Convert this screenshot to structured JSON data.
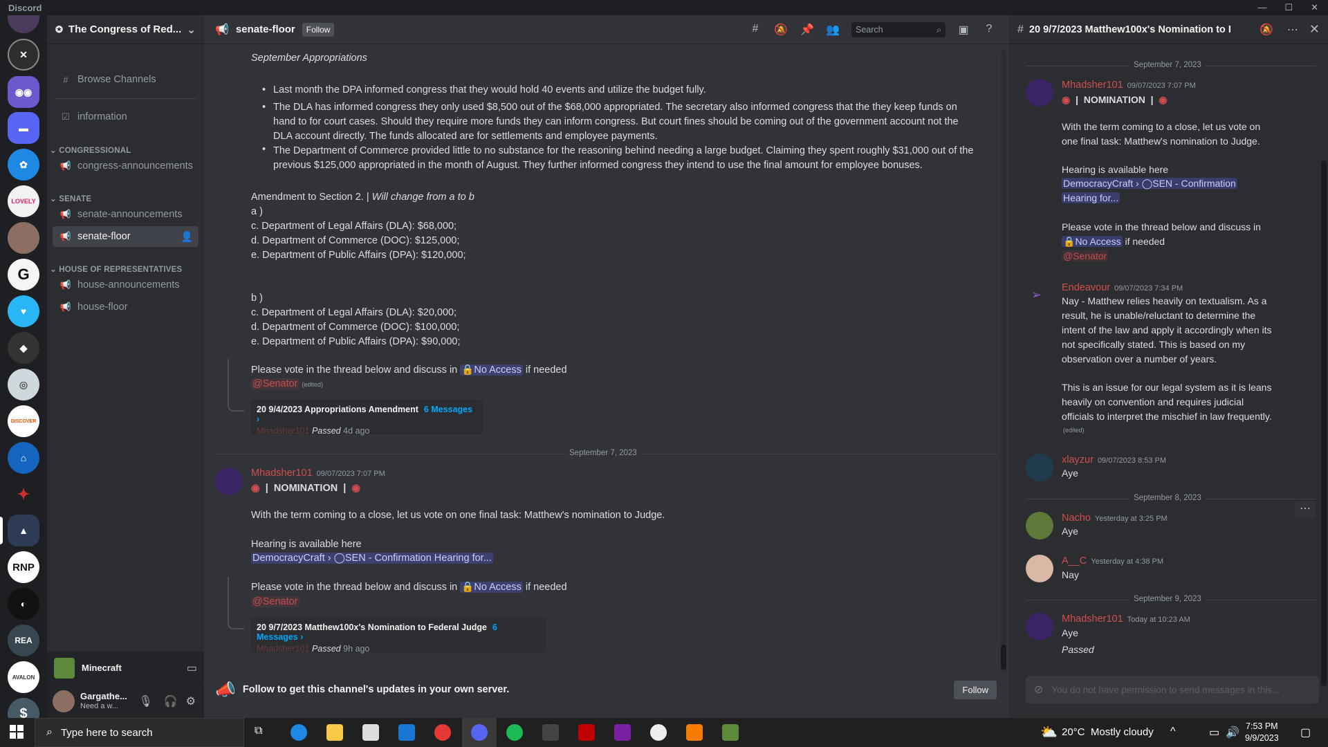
{
  "app": {
    "title": "Discord"
  },
  "server": {
    "name": "The Congress of Red..."
  },
  "sidebar": {
    "browse": "Browse Channels",
    "information": "information",
    "cat_congressional": "CONGRESSIONAL",
    "congress_announcements": "congress-announcements",
    "cat_senate": "SENATE",
    "senate_announcements": "senate-announcements",
    "senate_floor": "senate-floor",
    "cat_house": "HOUSE OF REPRESENTATIVES",
    "house_announcements": "house-announcements",
    "house_floor": "house-floor"
  },
  "voice": {
    "name": "Minecraft"
  },
  "user": {
    "name": "Gargathe...",
    "status": "Need a w..."
  },
  "header": {
    "channel": "senate-floor",
    "follow": "Follow",
    "search_placeholder": "Search"
  },
  "messages": {
    "heading": "September Appropriations",
    "bullets": [
      "Last month the DPA informed congress that they would hold 40 events and utilize the budget fully.",
      "The DLA has informed congress they only used $8,500 out of the $68,000 appropriated. The secretary also informed congress that the they keep funds on",
      "hand to for court cases. Should they require more funds they can inform congress. But court fines should be coming out of the government account not the",
      "DLA account directly. The funds allocated are for settlements and employee payments.",
      "The Department of Commerce provided little to no substance for the reasoning behind needing a large budget. Claiming they spent roughly $31,000 out of the",
      "previous $125,000 appropriated in the month of August. They further informed congress they intend to use the final amount for employee bonuses."
    ],
    "amend": "Amendment to Section 2. |",
    "amend_italic": "Will change from a to b",
    "a_lines": [
      "a )",
      "c. Department of Legal Affairs (DLA): $68,000;",
      "d. Department of Commerce (DOC): $125,000;",
      "e. Department of Public Affairs (DPA): $120,000;"
    ],
    "b_lines": [
      "b )",
      "c. Department of Legal Affairs (DLA): $20,000;",
      "d. Department of Commerce (DOC): $100,000;",
      "e. Department of Public Affairs (DPA): $90,000;"
    ],
    "vote_pre": "Please vote in the thread below and discuss in",
    "no_access": "No Access",
    "vote_post": "if needed",
    "senator": "@Senator",
    "edited": "(edited)",
    "thread1": {
      "title": "20 9/4/2023 Appropriations Amendment",
      "count": "6 Messages ›",
      "author": "Mhadsher101",
      "status": "Passed",
      "time": "4d ago"
    },
    "date1": "September 7, 2023",
    "m2_author": "Mhadsher101",
    "m2_time": "09/07/2023 7:07 PM",
    "nomination": "NOMINATION",
    "m2_text": "With the term coming to a close, let us vote on one final task: Matthew's nomination to Judge.",
    "hearing": "Hearing is available here",
    "hearing_link": "DemocracyCraft › ◯SEN - Confirmation Hearing for...",
    "thread2": {
      "title": "20 9/7/2023 Matthew100x's Nomination to Federal Judge",
      "count": "6 Messages ›",
      "author": "Mhadsher101",
      "status": "Passed",
      "time": "9h ago"
    }
  },
  "follow_bar": {
    "text": "Follow to get this channel's updates in your own server.",
    "button": "Follow"
  },
  "thread_panel": {
    "title": "20 9/7/2023 Matthew100x's Nomination to I",
    "date1": "September 7, 2023",
    "p1_author": "Mhadsher101",
    "p1_time": "09/07/2023 7:07 PM",
    "nomination": "NOMINATION",
    "p1_lines": [
      "With the term coming to a close, let us vote on",
      "one final task: Matthew's nomination to Judge."
    ],
    "hearing": "Hearing is available here",
    "link1": "DemocracyCraft › ◯SEN - Confirmation",
    "link2": "Hearing for...",
    "vote_pre": "Please vote in the thread below and discuss in",
    "no_access": "No Access",
    "vote_post": "if needed",
    "senator": "@Senator",
    "p2_author": "Endeavour",
    "p2_time": "09/07/2023 7:34 PM",
    "p2_lines": [
      "Nay - Matthew relies heavily on textualism. As a",
      "result, he is unable/reluctant to determine the",
      "intent of the law and apply it accordingly when its",
      "not specifically stated. This is based on my",
      "observation over a number of years."
    ],
    "p2b_lines": [
      "This is an issue for our legal system as it is leans",
      "heavily on convention and requires judicial",
      "officials to interpret the mischief in law frequently."
    ],
    "edited": "(edited)",
    "p3_author": "xlayzur",
    "p3_time": "09/07/2023 8:53 PM",
    "p3_text": "Aye",
    "date2": "September 8, 2023",
    "p4_author": "Nacho",
    "p4_time": "Yesterday at 3:25 PM",
    "p4_text": "Aye",
    "p5_author": "A__C",
    "p5_time": "Yesterday at 4:38 PM",
    "p5_text": "Nay",
    "date3": "September 9, 2023",
    "p6_author": "Mhadsher101",
    "p6_time": "Today at 10:23 AM",
    "p6_text": "Aye",
    "p6_passed": "Passed",
    "input_placeholder": "You do not have permission to send messages in this..."
  },
  "taskbar": {
    "search": "Type here to search",
    "weather": "20°C  Mostly cloudy",
    "time": "7:53 PM",
    "date": "9/9/2023"
  },
  "guild_labels": {
    "rnp": "RNP",
    "rea": "REA",
    "discover": "DISCOVER",
    "avalon": "AVALON",
    "lovely": "LOVELY"
  }
}
